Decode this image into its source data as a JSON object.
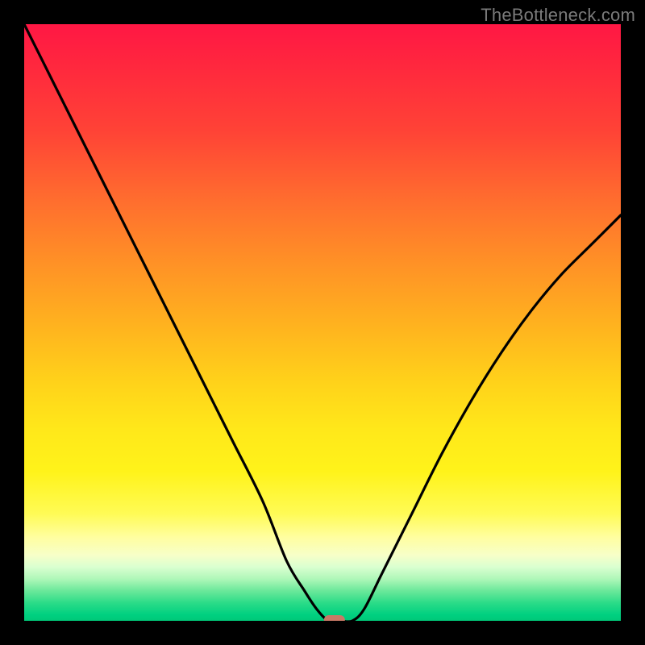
{
  "watermark": "TheBottleneck.com",
  "chart_data": {
    "type": "line",
    "title": "",
    "xlabel": "",
    "ylabel": "",
    "xlim": [
      0,
      100
    ],
    "ylim": [
      0,
      100
    ],
    "grid": false,
    "legend": false,
    "series": [
      {
        "name": "bottleneck-curve",
        "x": [
          0,
          5,
          10,
          15,
          20,
          25,
          30,
          35,
          40,
          44,
          47,
          49,
          51,
          53,
          55,
          57,
          60,
          65,
          70,
          75,
          80,
          85,
          90,
          95,
          100
        ],
        "y": [
          100,
          90,
          80,
          70,
          60,
          50,
          40,
          30,
          20,
          10,
          5,
          2,
          0,
          0,
          0,
          2,
          8,
          18,
          28,
          37,
          45,
          52,
          58,
          63,
          68
        ]
      }
    ],
    "annotations": [
      {
        "name": "min-marker",
        "x": 52,
        "y": 0,
        "shape": "rounded-rect",
        "color": "#c97a66"
      }
    ],
    "background_gradient": {
      "top": "#ff1744",
      "mid": "#ffd21a",
      "bottom": "#00c878"
    }
  }
}
